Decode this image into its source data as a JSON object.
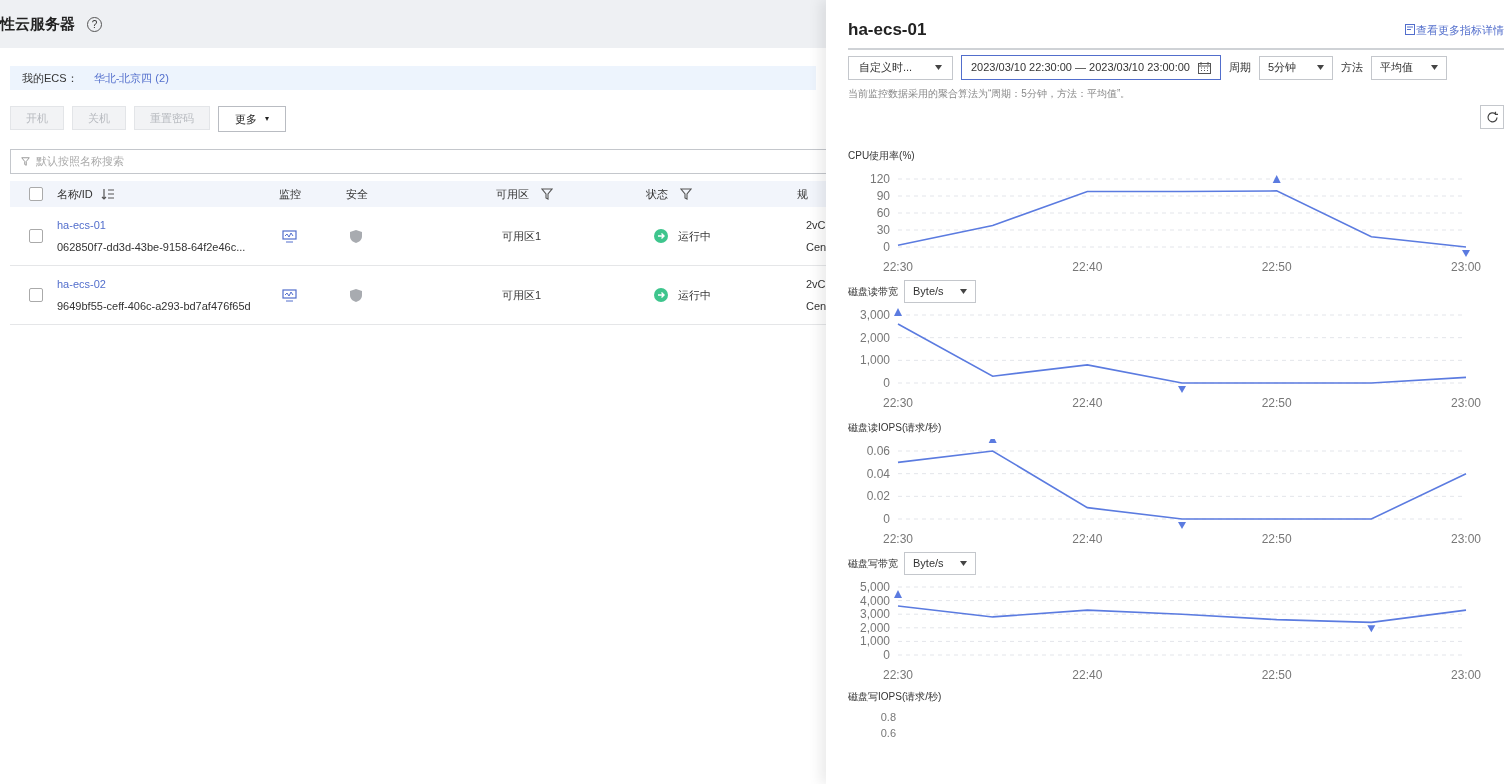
{
  "page": {
    "title": "性云服务器",
    "help": "?",
    "region_label": "我的ECS：",
    "region_link": "华北-北京四 (2)",
    "actions": [
      {
        "label": "开机",
        "disabled": true
      },
      {
        "label": "关机",
        "disabled": true
      },
      {
        "label": "重置密码",
        "disabled": true
      },
      {
        "label": "更多",
        "disabled": false,
        "caret": "▾"
      }
    ],
    "search": {
      "placeholder": "默认按照名称搜索"
    },
    "table": {
      "all_checked": false,
      "columns": [
        {
          "label": "名称/ID"
        },
        {
          "label": "监控"
        },
        {
          "label": "安全"
        },
        {
          "label": "可用区"
        },
        {
          "label": "状态"
        },
        {
          "label": "规"
        }
      ],
      "rows": [
        {
          "name": "ha-ecs-01",
          "id": "062850f7-dd3d-43be-9158-64f2e46c...",
          "checked": false,
          "zone": "可用区1",
          "status": "运行中",
          "spec_1": "2vC",
          "spec_2": "Cen"
        },
        {
          "name": "ha-ecs-02",
          "id": "9649bf55-ceff-406c-a293-bd7af476f65d",
          "checked": false,
          "zone": "可用区1",
          "status": "运行中",
          "spec_1": "2vC",
          "spec_2": "Cen"
        }
      ]
    }
  },
  "drawer": {
    "title": "ha-ecs-01",
    "more_link": "查看更多指标详情",
    "range_select": "自定义时...",
    "date_range": "2023/03/10 22:30:00 — 2023/03/10 23:00:00",
    "period_label": "周期",
    "period": "5分钟",
    "method_label": "方法",
    "method": "平均值",
    "note": "当前监控数据采用的聚合算法为“周期：5分钟，方法：平均值”。",
    "charts": [
      {
        "title": "CPU使用率(%)",
        "chart_data": {
          "type": "line",
          "grid": true,
          "categories": [
            "22:30",
            null,
            "22:40",
            null,
            "22:50",
            null,
            "23:00"
          ],
          "yticks": [
            {
              "value": 0,
              "label": "0"
            },
            {
              "value": 30,
              "label": "30"
            },
            {
              "value": 60,
              "label": "60"
            },
            {
              "value": 90,
              "label": "90"
            },
            {
              "value": 120,
              "label": "120"
            }
          ],
          "ylim": [
            0,
            120
          ],
          "series": [
            {
              "color": "#5b7be0",
              "values": [
                3,
                38,
                98,
                98,
                99,
                18,
                0
              ]
            }
          ]
        }
      },
      {
        "title": "磁盘读带宽",
        "unit": "Byte/s",
        "chart_data": {
          "type": "line",
          "grid": true,
          "categories": [
            "22:30",
            null,
            "22:40",
            null,
            "22:50",
            null,
            "23:00"
          ],
          "yticks": [
            {
              "value": 0,
              "label": "0"
            },
            {
              "value": 1000,
              "label": "1,000"
            },
            {
              "value": 2000,
              "label": "2,000"
            },
            {
              "value": 3000,
              "label": "3,000"
            }
          ],
          "ylim": [
            0,
            3000
          ],
          "series": [
            {
              "color": "#5b7be0",
              "values": [
                2600,
                300,
                800,
                0,
                0,
                0,
                250
              ]
            }
          ]
        }
      },
      {
        "title": "磁盘读IOPS(请求/秒)",
        "chart_data": {
          "type": "line",
          "grid": true,
          "categories": [
            "22:30",
            null,
            "22:40",
            null,
            "22:50",
            null,
            "23:00"
          ],
          "yticks": [
            {
              "value": 0,
              "label": "0"
            },
            {
              "value": 0.02,
              "label": "0.02"
            },
            {
              "value": 0.04,
              "label": "0.04"
            },
            {
              "value": 0.06,
              "label": "0.06"
            }
          ],
          "ylim": [
            0,
            0.06
          ],
          "series": [
            {
              "color": "#5b7be0",
              "values": [
                0.05,
                0.06,
                0.01,
                0,
                0,
                0,
                0.04
              ]
            }
          ]
        }
      },
      {
        "title": "磁盘写带宽",
        "unit": "Byte/s",
        "chart_data": {
          "type": "line",
          "grid": true,
          "categories": [
            "22:30",
            null,
            "22:40",
            null,
            "22:50",
            null,
            "23:00"
          ],
          "yticks": [
            {
              "value": 0,
              "label": "0"
            },
            {
              "value": 1000,
              "label": "1,000"
            },
            {
              "value": 2000,
              "label": "2,000"
            },
            {
              "value": 3000,
              "label": "3,000"
            },
            {
              "value": 4000,
              "label": "4,000"
            },
            {
              "value": 5000,
              "label": "5,000"
            }
          ],
          "ylim": [
            0,
            5000
          ],
          "series": [
            {
              "color": "#5b7be0",
              "values": [
                3600,
                2800,
                3300,
                3000,
                2600,
                2400,
                3300
              ]
            }
          ]
        }
      }
    ],
    "partial_chart": {
      "title": "磁盘写IOPS(请求/秒)",
      "y_labels": [
        "0.8",
        "0.6"
      ]
    }
  }
}
